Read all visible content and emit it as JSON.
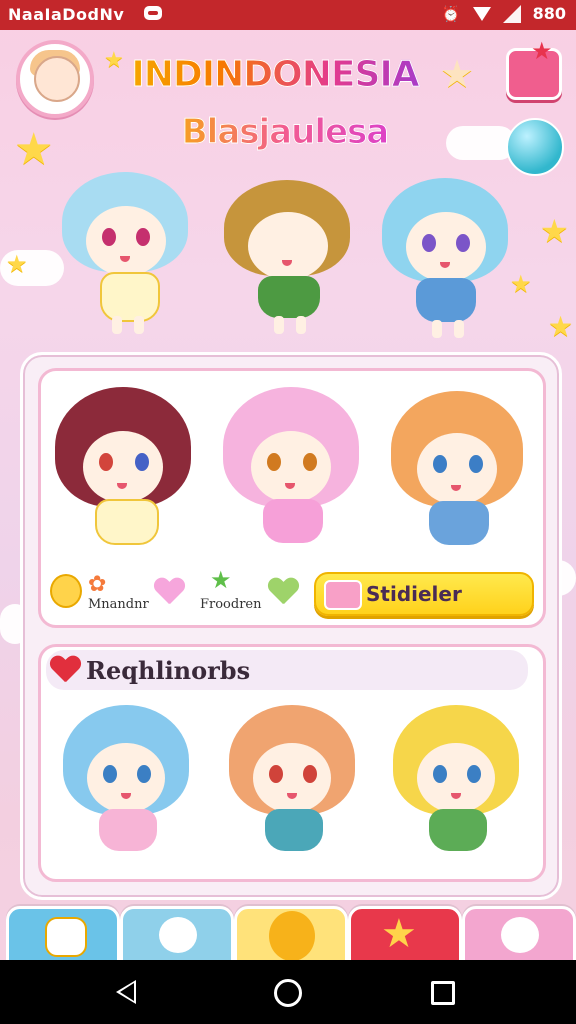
{
  "status_bar": {
    "app_title": "NaaIaDodNv",
    "right_text": "880"
  },
  "header": {
    "title": "INDINDONESIA",
    "subtitle": "Blasjaulesa"
  },
  "featured": {
    "label_1": "Mnandnr",
    "label_2": "Froodren",
    "action_label": "Stidieler"
  },
  "section": {
    "title": "Reqhlinorbs"
  },
  "colors": {
    "statusbar": "#c3272b",
    "panel_border": "#f3b9d3",
    "action_yellow": "#ffd21c",
    "tab_colors": [
      "#6ac3e8",
      "#8fd0ea",
      "#ffe27a",
      "#e8384b",
      "#f3a6cf"
    ]
  },
  "tabs": [
    {
      "icon": "cake-icon"
    },
    {
      "icon": "mascot-icon"
    },
    {
      "icon": "balloon-icon"
    },
    {
      "icon": "star-icon"
    },
    {
      "icon": "bear-icon"
    }
  ],
  "nav": {
    "back": "back-icon",
    "home": "home-icon",
    "recent": "recents-icon"
  }
}
